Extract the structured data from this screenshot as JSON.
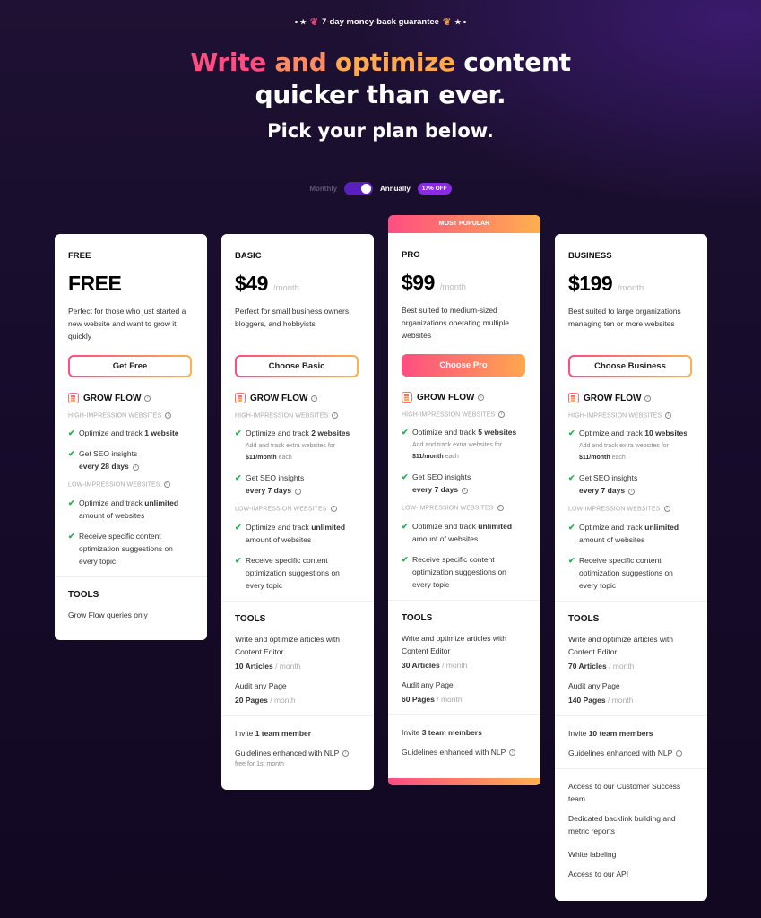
{
  "guarantee": "7-day money-back guarantee",
  "hero": {
    "line1_part1": "Write",
    "line1_part2": "and",
    "line1_part3": "optimize",
    "line1_part4": "content",
    "line2": "quicker than ever.",
    "line3": "Pick your plan below."
  },
  "billing": {
    "monthly_label": "Monthly",
    "annually_label": "Annually",
    "discount_badge": "17% OFF",
    "selected": "Annually"
  },
  "common": {
    "grow_flow": "GROW FLOW",
    "high_impression": "HIGH-IMPRESSION WEBSITES",
    "low_impression": "LOW-IMPRESSION WEBSITES",
    "per_month": "/month",
    "tools": "TOOLS",
    "optimize_track_prefix": "Optimize and track",
    "extra_sites_prefix": "Add and track extra websites for",
    "extra_sites_price": "$11/month",
    "extra_sites_suffix": "each",
    "seo_insights": "Get SEO insights",
    "unlimited": "unlimited",
    "amount_of_websites": "amount of websites",
    "content_suggestions": "Receive specific content optimization suggestions on every topic",
    "write_optimize": "Write and optimize articles with Content Editor",
    "audit_page": "Audit any Page",
    "slash_month": "/ month",
    "invite": "Invite",
    "nlp": "Guidelines enhanced with NLP",
    "most_popular": "MOST POPULAR"
  },
  "plans": [
    {
      "name": "FREE",
      "price": "FREE",
      "description": "Perfect for those who just started a new website and want to grow it quickly",
      "button": "Get Free",
      "websites": "1 website",
      "seo_frequency": "every 28 days",
      "tools_text": "Grow Flow queries only"
    },
    {
      "name": "BASIC",
      "price": "$49",
      "description": "Perfect for small business owners, bloggers, and hobbyists",
      "button": "Choose Basic",
      "websites": "2 websites",
      "seo_frequency": "every 7 days",
      "articles": "10 Articles",
      "pages": "20 Pages",
      "team": "1 team member",
      "nlp_note": "free for 1st month"
    },
    {
      "name": "PRO",
      "price": "$99",
      "description": "Best suited to medium-sized organizations operating multiple websites",
      "button": "Choose Pro",
      "websites": "5 websites",
      "seo_frequency": "every 7 days",
      "articles": "30 Articles",
      "pages": "60 Pages",
      "team": "3 team members",
      "popular": true
    },
    {
      "name": "BUSINESS",
      "price": "$199",
      "description": "Best suited to large organizations managing ten or more websites",
      "button": "Choose Business",
      "websites": "10 websites",
      "seo_frequency": "every 7 days",
      "articles": "70 Articles",
      "pages": "140 Pages",
      "team": "10 team members",
      "extras": [
        "Access to our Customer Success team",
        "Dedicated backlink building and metric reports",
        "White labeling",
        "Access to our API"
      ]
    }
  ]
}
